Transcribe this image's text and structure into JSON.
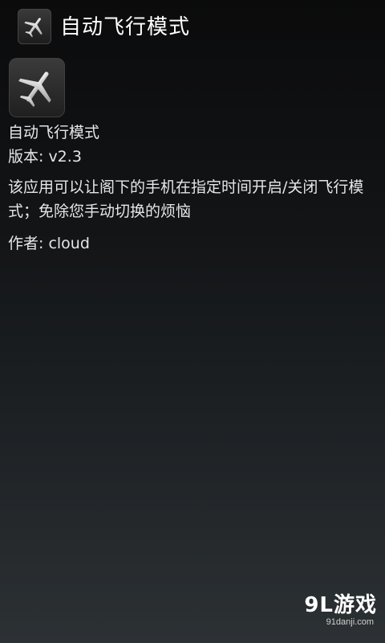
{
  "header": {
    "title": "自动飞行模式",
    "icon": "airplane-icon"
  },
  "about": {
    "app_name": "自动飞行模式",
    "version": "版本: v2.3",
    "description": "该应用可以让阁下的手机在指定时间开启/关闭飞行模式；免除您手动切换的烦恼",
    "author": "作者: cloud"
  },
  "watermark": {
    "logo_text": "9L游戏",
    "url": "91danji.com"
  },
  "colors": {
    "background_top": "#0b0b0c",
    "background_bottom": "#2c3134",
    "text": "#e6e6e6"
  }
}
